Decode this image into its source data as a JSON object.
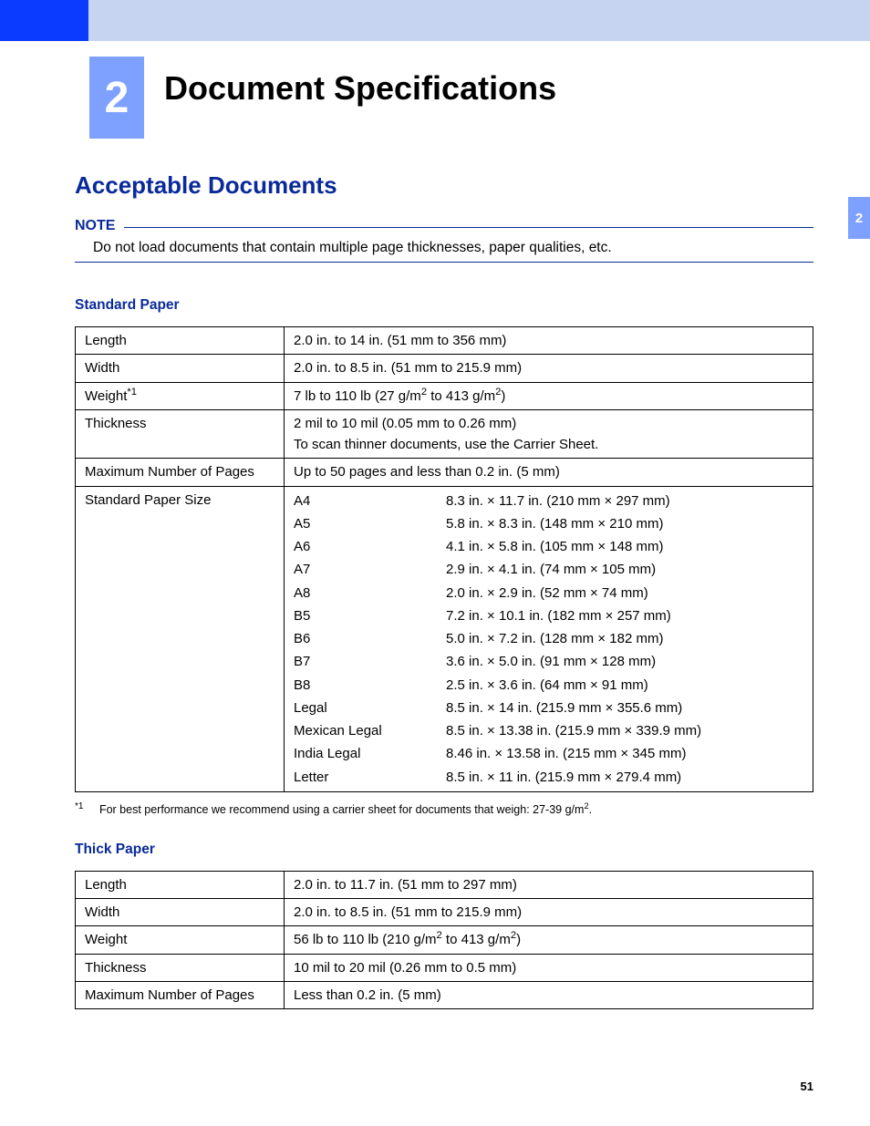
{
  "chapter": {
    "number": "2",
    "title": "Document Specifications"
  },
  "side_tab": "2",
  "page_number": "51",
  "section": {
    "title": "Acceptable Documents"
  },
  "note": {
    "label": "NOTE",
    "text": "Do not load documents that contain multiple page thicknesses, paper qualities, etc."
  },
  "standard_paper": {
    "heading": "Standard Paper",
    "rows": {
      "length": {
        "label": "Length",
        "value": "2.0 in. to 14 in. (51 mm to 356 mm)"
      },
      "width": {
        "label": "Width",
        "value": "2.0 in. to 8.5 in. (51 mm to 215.9 mm)"
      },
      "weight": {
        "label_prefix": "Weight",
        "ref": "*1",
        "value_pre": "7 lb to 110 lb (27 g/m",
        "value_mid": " to 413 g/m",
        "value_post": ")"
      },
      "thickness": {
        "label": "Thickness",
        "value_line1": "2 mil to 10 mil (0.05 mm to 0.26 mm)",
        "value_line2": "To scan thinner documents, use the Carrier Sheet."
      },
      "max_pages": {
        "label": "Maximum Number of Pages",
        "value": "Up to 50 pages and less than 0.2 in. (5 mm)"
      },
      "std_size_label": "Standard Paper Size",
      "sizes": [
        {
          "name": "A4",
          "dim": "8.3 in. × 11.7 in. (210 mm × 297 mm)"
        },
        {
          "name": "A5",
          "dim": "5.8 in. × 8.3 in. (148 mm × 210 mm)"
        },
        {
          "name": "A6",
          "dim": "4.1 in. × 5.8 in. (105 mm × 148 mm)"
        },
        {
          "name": "A7",
          "dim": "2.9 in. × 4.1 in. (74 mm × 105 mm)"
        },
        {
          "name": "A8",
          "dim": "2.0 in. × 2.9 in. (52 mm × 74 mm)"
        },
        {
          "name": "B5",
          "dim": "7.2 in. × 10.1 in. (182 mm × 257 mm)"
        },
        {
          "name": "B6",
          "dim": "5.0 in. × 7.2 in. (128 mm × 182 mm)"
        },
        {
          "name": "B7",
          "dim": "3.6 in. × 5.0 in. (91 mm × 128 mm)"
        },
        {
          "name": "B8",
          "dim": "2.5 in. × 3.6 in. (64 mm × 91 mm)"
        },
        {
          "name": "Legal",
          "dim": "8.5 in. × 14 in. (215.9 mm × 355.6 mm)"
        },
        {
          "name": "Mexican Legal",
          "dim": "8.5 in. × 13.38 in. (215.9 mm × 339.9 mm)"
        },
        {
          "name": "India Legal",
          "dim": "8.46 in. × 13.58 in. (215 mm × 345 mm)"
        },
        {
          "name": "Letter",
          "dim": "8.5 in. × 11 in. (215.9 mm × 279.4 mm)"
        }
      ]
    },
    "footnote": {
      "ref": "*1",
      "text_pre": "For best performance we recommend using a carrier sheet for documents that weigh: 27-39 g/m",
      "text_post": "."
    }
  },
  "thick_paper": {
    "heading": "Thick Paper",
    "rows": {
      "length": {
        "label": "Length",
        "value": "2.0 in. to 11.7 in. (51 mm to 297 mm)"
      },
      "width": {
        "label": "Width",
        "value": "2.0 in. to 8.5 in. (51 mm to 215.9 mm)"
      },
      "weight": {
        "label": "Weight",
        "value_pre": "56 lb to 110 lb (210 g/m",
        "value_mid": " to 413 g/m",
        "value_post": ")"
      },
      "thickness": {
        "label": "Thickness",
        "value": "10 mil to 20 mil (0.26 mm to 0.5 mm)"
      },
      "max_pages": {
        "label": "Maximum Number of Pages",
        "value": "Less than 0.2 in. (5 mm)"
      }
    }
  }
}
